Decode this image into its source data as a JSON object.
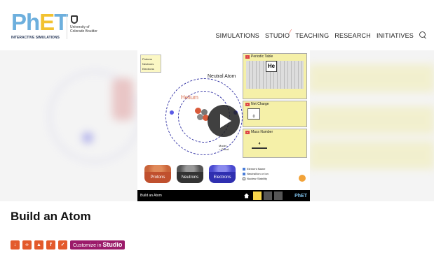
{
  "brand": {
    "logo_ph": "Ph",
    "logo_e": "E",
    "logo_t": "T",
    "logo_sub": "INTERACTIVE SIMULATIONS",
    "university": "University of Colorado Boulder"
  },
  "nav": {
    "items": [
      "SIMULATIONS",
      "STUDIO",
      "TEACHING",
      "RESEARCH",
      "INITIATIVES"
    ]
  },
  "sim": {
    "counts": [
      "Protons",
      "Neutrons",
      "Electrons"
    ],
    "atom_label": "Neutral Atom",
    "element_name": "Helium",
    "model_label": "Model",
    "model_option": "Cloud",
    "buckets": [
      "Protons",
      "Neutrons",
      "Electrons"
    ],
    "panels": [
      "Periodic Table",
      "Net Charge",
      "Mass Number"
    ],
    "periodic_symbol": "He",
    "net_charge_value": "0",
    "mass_number_value": "4",
    "checks": [
      "Element Name",
      "Neutral/Ion or Ion",
      "Nuclear Stability"
    ],
    "bottom_title": "Build an Atom",
    "bottom_phet": "PhET"
  },
  "page": {
    "title": "Build an Atom",
    "customize_prefix": "Customize in ",
    "customize_studio": "Studio"
  },
  "colors": {
    "accent_blue": "#6dafdd",
    "accent_yellow": "#f2c230",
    "share_orange": "#e35a2b",
    "studio_purple": "#9b1b6a"
  }
}
